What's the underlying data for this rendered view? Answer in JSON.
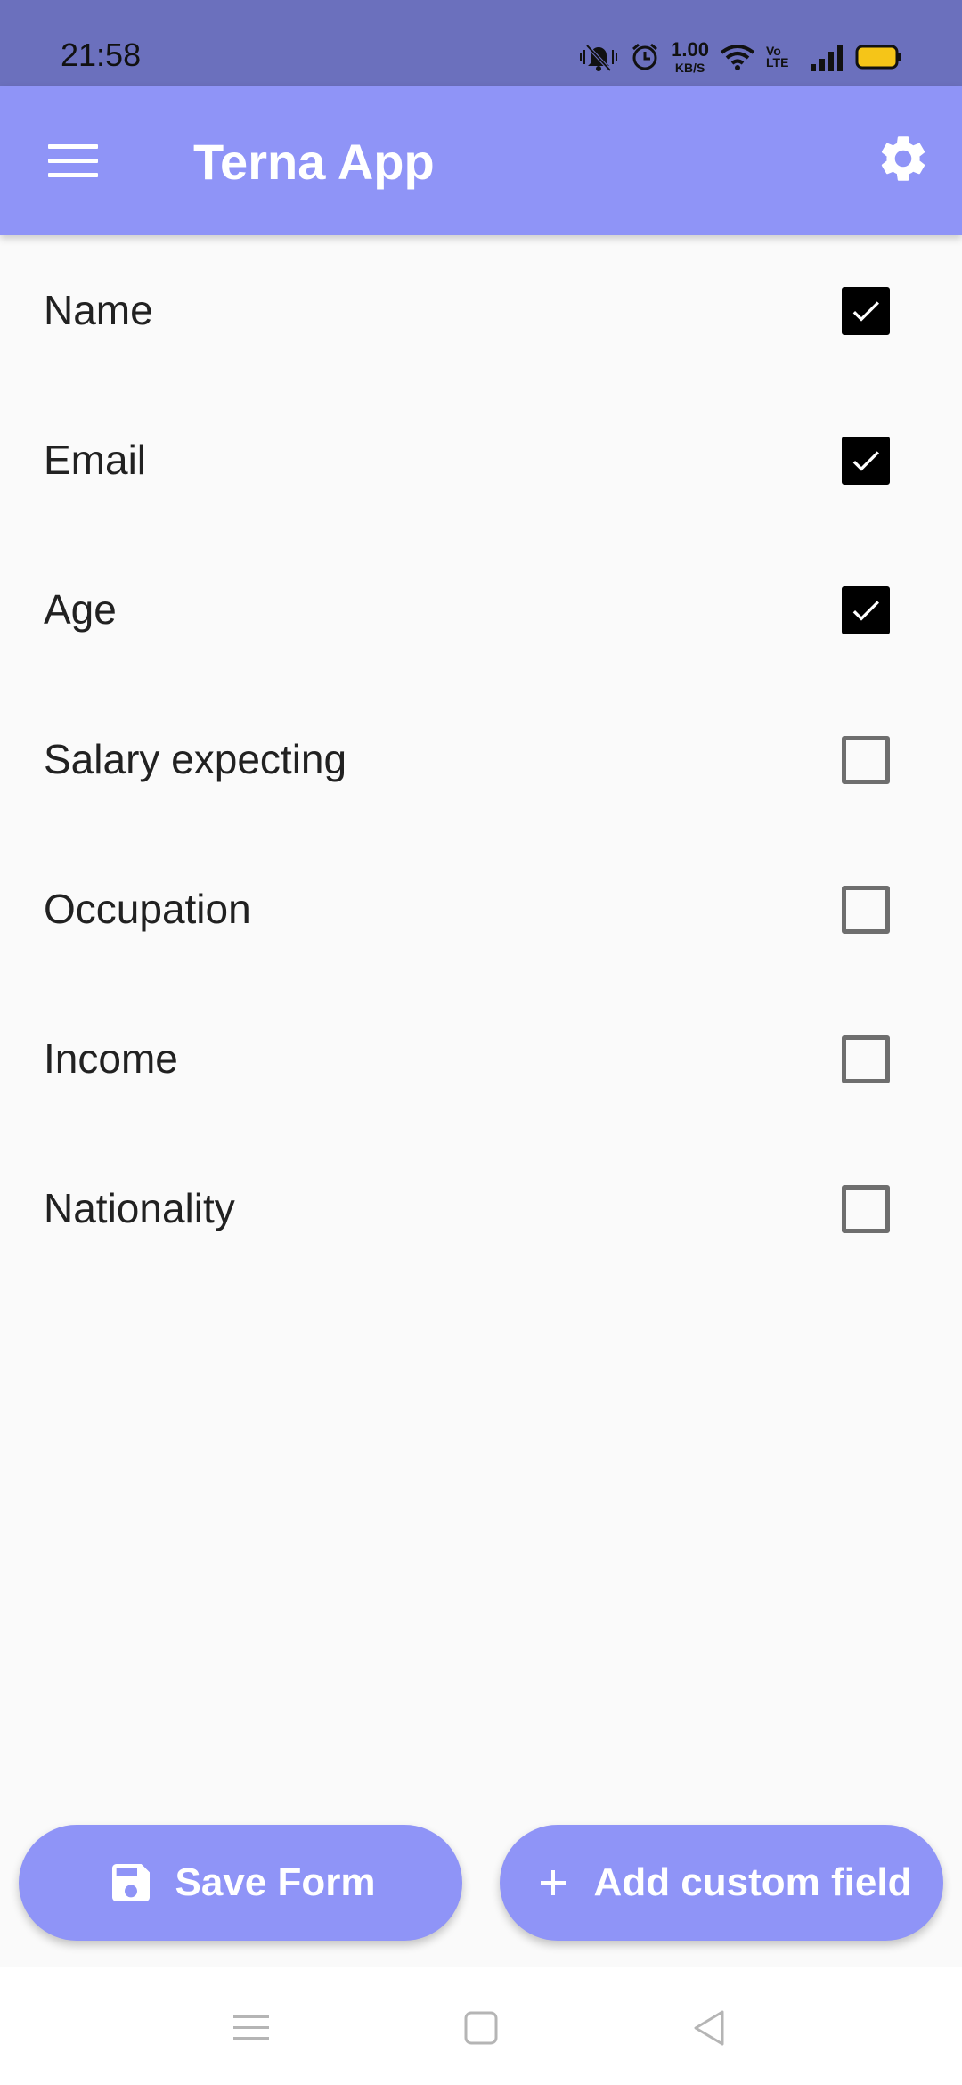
{
  "status_bar": {
    "time": "21:58",
    "net_speed_value": "1.00",
    "net_speed_unit": "KB/S",
    "volte_line1": "Vo",
    "volte_line2": "LTE"
  },
  "app_bar": {
    "title": "Terna App",
    "menu_icon": "hamburger-menu-icon",
    "settings_icon": "gear-icon"
  },
  "fields": [
    {
      "label": "Name",
      "checked": true
    },
    {
      "label": "Email",
      "checked": true
    },
    {
      "label": "Age",
      "checked": true
    },
    {
      "label": "Salary expecting",
      "checked": false
    },
    {
      "label": "Occupation",
      "checked": false
    },
    {
      "label": "Income",
      "checked": false
    },
    {
      "label": "Nationality",
      "checked": false
    }
  ],
  "actions": {
    "save_label": "Save Form",
    "save_icon": "save-icon",
    "add_label": "Add custom field",
    "add_icon": "plus-icon"
  },
  "colors": {
    "status_bar": "#6b70bd",
    "app_bar": "#8f94f7",
    "accent": "#8f94f7",
    "background": "#fafafa",
    "battery": "#f5c518"
  }
}
